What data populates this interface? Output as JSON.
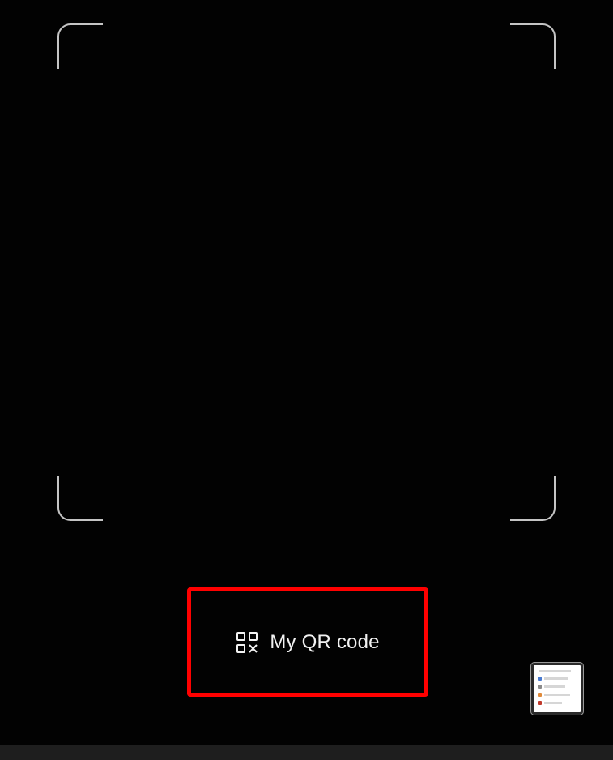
{
  "qr_button": {
    "label": "My QR code",
    "icon": "qr-code-icon",
    "highlight_color": "#ff0000"
  },
  "scanner": {
    "frame_color": "#d9d9d9",
    "background": "#020202"
  },
  "gallery_thumbnail": {
    "icon": "recent-image-thumbnail"
  },
  "navigation_bar": {
    "background": "#1e1e1e"
  }
}
